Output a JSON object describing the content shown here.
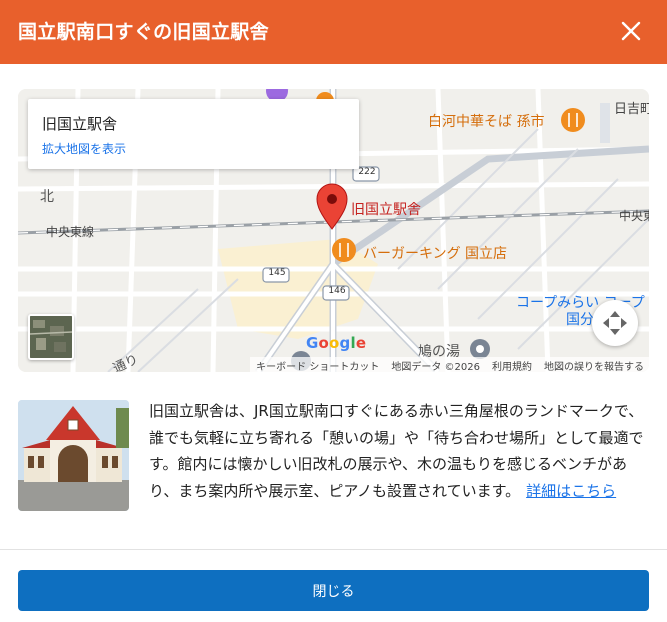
{
  "header": {
    "title": "国立駅南口すぐの旧国立駅舎",
    "close_icon": "close-icon"
  },
  "map": {
    "card": {
      "title": "旧国立駅舎",
      "link": "拡大地図を表示"
    },
    "labels": {
      "marker": "旧国立駅舎",
      "burger": "バーガーキング 国立店",
      "shirakawa": "白河中華そば 孫市",
      "north": "北",
      "chuo_line_west": "中央東線",
      "chuo_line_east": "中央東",
      "hiyoshi": "日吉町",
      "coop": "コープみらい コープ",
      "kunibun": "国分",
      "hatonoyu": "鳩の湯",
      "road": "通り",
      "route_222": "222",
      "route_145": "145",
      "route_146": "146"
    },
    "google_logo": "Google",
    "attribution": {
      "shortcuts": "キーボード ショートカット",
      "data": "地図データ ©2026",
      "terms": "利用規約",
      "report": "地図の誤りを報告する"
    },
    "colors": {
      "marker": "#ea4335",
      "restaurant": "#f08c1e",
      "marker_label": "#c5221f",
      "restaurant_label": "#d56e0c",
      "transit_label": "#1a73e8"
    }
  },
  "description": {
    "text": "旧国立駅舎は、JR国立駅南口すぐにある赤い三角屋根のランドマークで、誰でも気軽に立ち寄れる「憩いの場」や「待ち合わせ場所」として最適です。館内には懐かしい旧改札の展示や、木の温もりを感じるベンチがあり、まち案内所や展示室、ピアノも設置されています。",
    "link": "詳細はこちら"
  },
  "footer": {
    "close_label": "閉じる"
  },
  "theme": {
    "header_bg": "#e8602c",
    "button_bg": "#0e6fc0",
    "link": "#1a73e8"
  }
}
